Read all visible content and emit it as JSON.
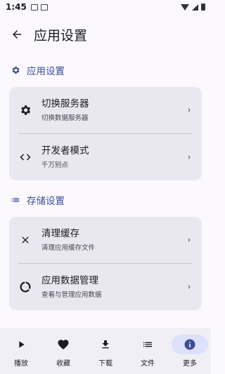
{
  "status_bar": {
    "time": "1:45"
  },
  "app_bar": {
    "title": "应用设置"
  },
  "sections": [
    {
      "header": "应用设置",
      "icon": "gear-icon",
      "items": [
        {
          "title": "切换服务器",
          "subtitle": "切换数据服务器",
          "icon": "gear-icon"
        },
        {
          "title": "开发者模式",
          "subtitle": "千万别点",
          "icon": "code-icon"
        }
      ]
    },
    {
      "header": "存储设置",
      "icon": "list-icon",
      "items": [
        {
          "title": "清理缓存",
          "subtitle": "清理应用缓存文件",
          "icon": "close-icon"
        },
        {
          "title": "应用数据管理",
          "subtitle": "查看与管理应用数据",
          "icon": "storage-icon"
        }
      ]
    }
  ],
  "nav": [
    {
      "label": "播放",
      "icon": "play-icon",
      "active": false
    },
    {
      "label": "收藏",
      "icon": "heart-icon",
      "active": false
    },
    {
      "label": "下载",
      "icon": "download-icon",
      "active": false
    },
    {
      "label": "文件",
      "icon": "file-list-icon",
      "active": false
    },
    {
      "label": "更多",
      "icon": "info-icon",
      "active": true
    }
  ],
  "colors": {
    "accent": "#3d4e95",
    "card": "#e9e8f0",
    "background": "#fbf9fe",
    "active_pill": "#dde1f9"
  }
}
